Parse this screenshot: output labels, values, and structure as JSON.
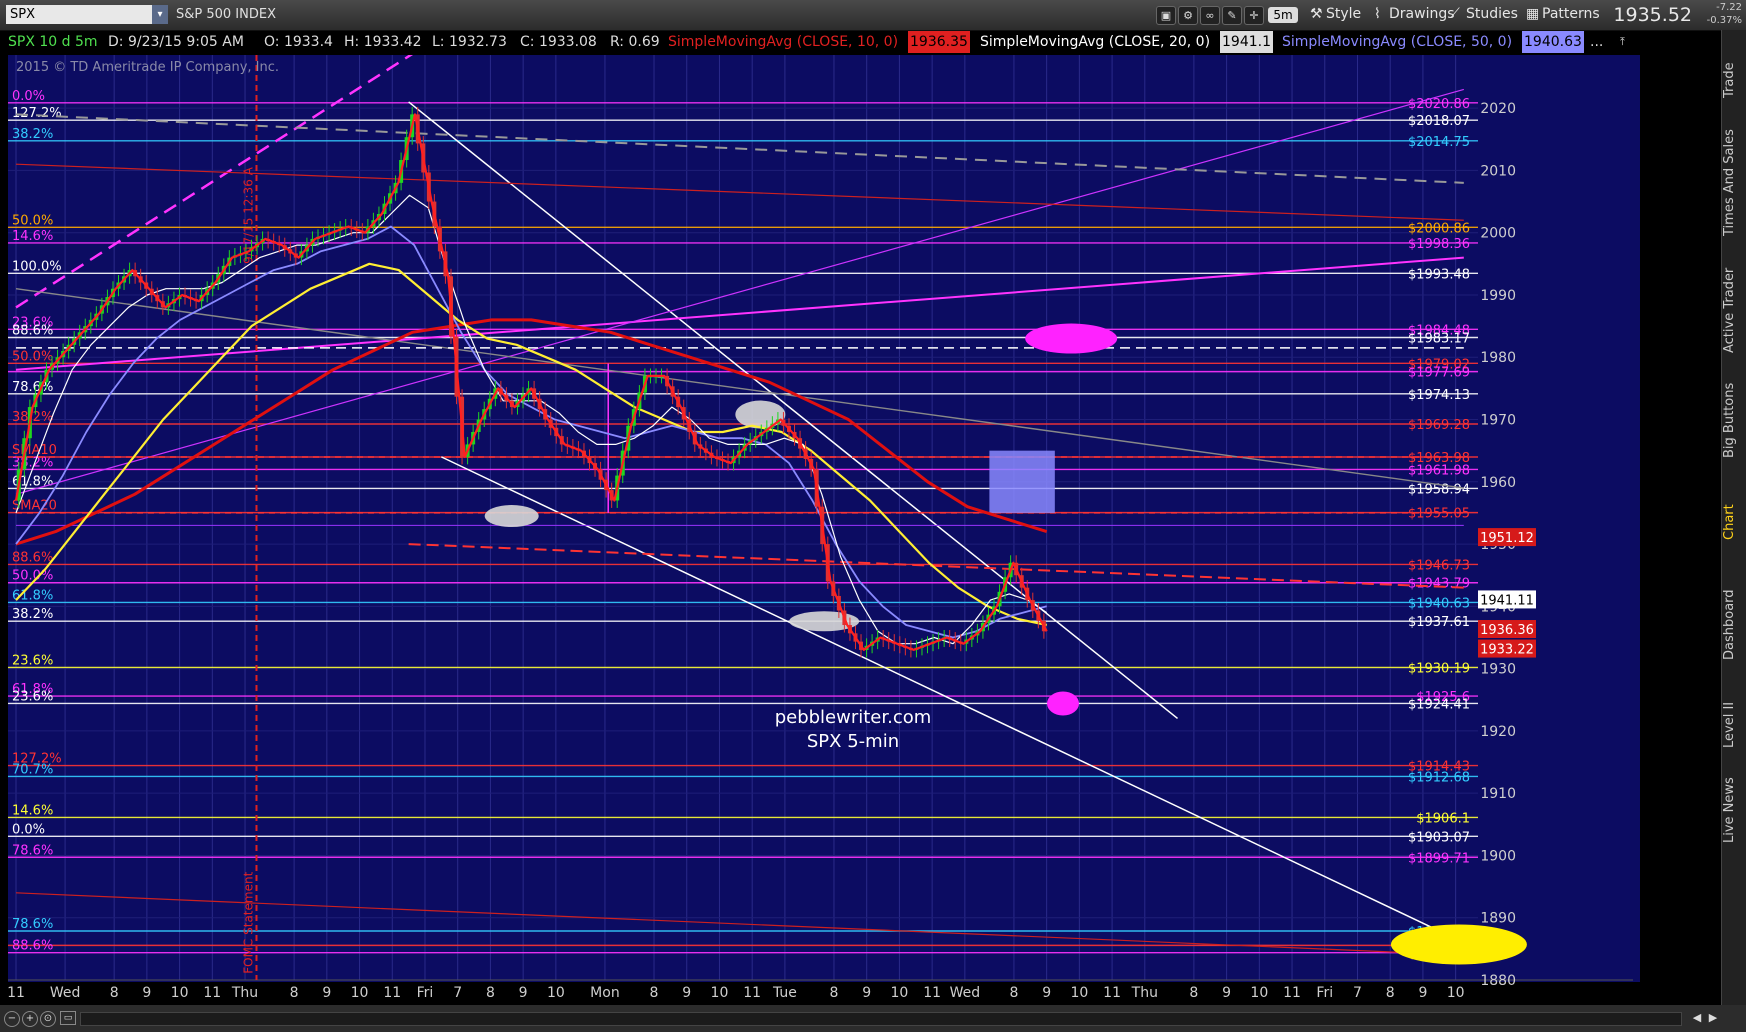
{
  "toolbar": {
    "symbol": "SPX",
    "symbol_name": "S&P 500 INDEX",
    "interval": "5m",
    "style_label": "Style",
    "drawings_label": "Drawings",
    "studies_label": "Studies",
    "patterns_label": "Patterns",
    "last_price": "1935.52",
    "change": "-7.22",
    "change_pct": "-0.37%"
  },
  "infobar": {
    "title": "SPX 10 d 5m",
    "date": "D: 9/23/15 9:05 AM",
    "open": "O: 1933.4",
    "high": "H: 1933.42",
    "low": "L: 1932.73",
    "close": "C: 1933.08",
    "range": "R: 0.69",
    "sma10_label": "SimpleMovingAvg (CLOSE, 10, 0)",
    "sma10_value": "1936.35",
    "sma20_label": "SimpleMovingAvg (CLOSE, 20, 0)",
    "sma20_value": "1941.1",
    "sma50_label": "SimpleMovingAvg (CLOSE, 50, 0)",
    "sma50_value": "1940.63",
    "more": "..."
  },
  "right_tabs": [
    "Trade",
    "Times And Sales",
    "Active Trader",
    "Big Buttons",
    "Chart",
    "Dashboard",
    "Level II",
    "Live News"
  ],
  "colors": {
    "background": "#0c0c62",
    "candle_up": "#1fd61f",
    "candle_down": "#e03030",
    "sma10": "#ffffff",
    "sma20": "#8a8aff",
    "sma50": "#ffee33",
    "sma200": "#e01010",
    "magenta": "#ff22ff",
    "trendline": "#ffffff"
  },
  "chart_data": {
    "type": "candlestick",
    "title": "SPX 5-min",
    "watermark": "pebblewriter.com",
    "copyright": "2015 © TD Ameritrade IP Company, Inc.",
    "ylim": [
      1880,
      2025
    ],
    "y_ticks": [
      2020,
      2010,
      2000,
      1990,
      1980,
      1970,
      1960,
      1950,
      1940,
      1930,
      1920,
      1910,
      1900,
      1890,
      1880
    ],
    "x_tick_labels": [
      {
        "x": 0,
        "label": "11"
      },
      {
        "x": 3,
        "label": "Wed"
      },
      {
        "x": 6,
        "label": "8"
      },
      {
        "x": 8,
        "label": "9"
      },
      {
        "x": 10,
        "label": "10"
      },
      {
        "x": 12,
        "label": "11"
      },
      {
        "x": 14,
        "label": "Thu"
      },
      {
        "x": 17,
        "label": "8"
      },
      {
        "x": 19,
        "label": "9"
      },
      {
        "x": 21,
        "label": "10"
      },
      {
        "x": 23,
        "label": "11"
      },
      {
        "x": 25,
        "label": "Fri"
      },
      {
        "x": 27,
        "label": "7"
      },
      {
        "x": 29,
        "label": "8"
      },
      {
        "x": 31,
        "label": "9"
      },
      {
        "x": 33,
        "label": "10"
      },
      {
        "x": 36,
        "label": "Mon"
      },
      {
        "x": 39,
        "label": "8"
      },
      {
        "x": 41,
        "label": "9"
      },
      {
        "x": 43,
        "label": "10"
      },
      {
        "x": 45,
        "label": "11"
      },
      {
        "x": 47,
        "label": "Tue"
      },
      {
        "x": 50,
        "label": "8"
      },
      {
        "x": 52,
        "label": "9"
      },
      {
        "x": 54,
        "label": "10"
      },
      {
        "x": 56,
        "label": "11"
      },
      {
        "x": 58,
        "label": "Wed"
      },
      {
        "x": 61,
        "label": "8"
      },
      {
        "x": 63,
        "label": "9"
      },
      {
        "x": 65,
        "label": "10"
      },
      {
        "x": 67,
        "label": "11"
      },
      {
        "x": 69,
        "label": "Thu"
      },
      {
        "x": 72,
        "label": "8"
      },
      {
        "x": 74,
        "label": "9"
      },
      {
        "x": 76,
        "label": "10"
      },
      {
        "x": 78,
        "label": "11"
      },
      {
        "x": 80,
        "label": "Fri"
      },
      {
        "x": 82,
        "label": "7"
      },
      {
        "x": 84,
        "label": "8"
      },
      {
        "x": 86,
        "label": "9"
      },
      {
        "x": 88,
        "label": "10"
      }
    ],
    "x_max": 89,
    "fomc_x": 14.7,
    "fomc_label": "FOMC Statement",
    "fomc_time": "9/17/15 12:36 A",
    "close_series": [
      1957,
      1972,
      1978,
      1981,
      1984,
      1987,
      1991,
      1994,
      1991,
      1988,
      1990,
      1989,
      1992,
      1996,
      1997,
      1999,
      1998,
      1996,
      1999,
      2000,
      2001,
      2000,
      2003,
      2008,
      2019,
      2005,
      1993,
      1964,
      1970,
      1975,
      1972,
      1975,
      1970,
      1966,
      1965,
      1962,
      1957,
      1969,
      1977,
      1977,
      1972,
      1966,
      1964,
      1963,
      1966,
      1968,
      1970,
      1967,
      1962,
      1944,
      1937,
      1933,
      1935,
      1934,
      1933,
      1934,
      1935,
      1934,
      1936,
      1940,
      1947,
      1941,
      1936
    ],
    "sma10_series": [
      1955,
      1963,
      1971,
      1978,
      1982,
      1985,
      1988,
      1990,
      1991,
      1991,
      1991,
      1992,
      1994,
      1996,
      1997,
      1998,
      1998,
      1999,
      2000,
      2000,
      2003,
      2006,
      2004,
      1994,
      1985,
      1978,
      1973,
      1973,
      1973,
      1971,
      1968,
      1966,
      1966,
      1967,
      1969,
      1972,
      1970,
      1967,
      1966,
      1966,
      1966,
      1967,
      1966,
      1958,
      1948,
      1941,
      1936,
      1934,
      1934,
      1935,
      1934,
      1937,
      1941,
      1942,
      1941,
      1939
    ],
    "sma20_series": [
      1950,
      1955,
      1961,
      1968,
      1974,
      1979,
      1983,
      1986,
      1988,
      1990,
      1992,
      1994,
      1995,
      1997,
      1998,
      1999,
      2001,
      1998,
      1991,
      1984,
      1978,
      1974,
      1972,
      1970,
      1969,
      1968,
      1967,
      1968,
      1969,
      1968,
      1967,
      1967,
      1966,
      1963,
      1957,
      1950,
      1944,
      1940,
      1937,
      1936,
      1935,
      1936,
      1938,
      1939,
      1940
    ],
    "sma50_series": [
      1941,
      1946,
      1952,
      1958,
      1964,
      1970,
      1975,
      1980,
      1985,
      1988,
      1991,
      1993,
      1995,
      1994,
      1990,
      1986,
      1983,
      1982,
      1980,
      1978,
      1975,
      1972,
      1970,
      1968,
      1968,
      1969,
      1968,
      1965,
      1961,
      1957,
      1952,
      1947,
      1943,
      1940,
      1938,
      1937
    ],
    "sma200_series": [
      1950,
      1952,
      1955,
      1958,
      1962,
      1966,
      1970,
      1974,
      1978,
      1981,
      1984,
      1985,
      1986,
      1986,
      1985,
      1984,
      1982,
      1980,
      1978,
      1976,
      1973,
      1970,
      1965,
      1960,
      1956,
      1954,
      1952
    ],
    "levels": [
      {
        "price": 2020.86,
        "label": "$2020.86",
        "left_label": "0.0%",
        "color": "#ff33ff"
      },
      {
        "price": 2018.07,
        "label": "$2018.07",
        "left_label": "127.2%",
        "color": "#ffffff"
      },
      {
        "price": 2014.75,
        "label": "$2014.75",
        "left_label": "38.2%",
        "color": "#33ccff"
      },
      {
        "price": 2000.86,
        "label": "$2000.86",
        "left_label": "50.0%",
        "color": "#ffaa00"
      },
      {
        "price": 1998.36,
        "label": "$1998.36",
        "left_label": "14.6%",
        "color": "#ff33ff"
      },
      {
        "price": 1993.48,
        "label": "$1993.48",
        "left_label": "100.0%",
        "color": "#ffffff"
      },
      {
        "price": 1984.48,
        "label": "$1984.48",
        "left_label": "23.6%",
        "color": "#ff33ff"
      },
      {
        "price": 1983.17,
        "label": "$1983.17",
        "left_label": "88.6%",
        "color": "#ffffff"
      },
      {
        "price": 1979.02,
        "label": "$1979.02",
        "left_label": "50.0%",
        "color": "#ff3333"
      },
      {
        "price": 1977.69,
        "label": "$1977.69",
        "left_label": "",
        "color": "#ff33ff"
      },
      {
        "price": 1974.13,
        "label": "$1974.13",
        "left_label": "78.6%",
        "color": "#ffffff"
      },
      {
        "price": 1969.28,
        "label": "$1969.28",
        "left_label": "38.2%",
        "color": "#ff3333"
      },
      {
        "price": 1963.98,
        "label": "$1963.98",
        "left_label": "SMA10",
        "color": "#ff3333"
      },
      {
        "price": 1961.98,
        "label": "$1961.98",
        "left_label": "38.2%",
        "color": "#ff33ff"
      },
      {
        "price": 1958.94,
        "label": "$1958.94",
        "left_label": "61.8%",
        "color": "#ffffff"
      },
      {
        "price": 1955.05,
        "label": "$1955.05",
        "left_label": "SMA20",
        "color": "#ff3333"
      },
      {
        "price": 1946.73,
        "label": "$1946.73",
        "left_label": "88.6%",
        "color": "#ff3333"
      },
      {
        "price": 1943.79,
        "label": "$1943.79",
        "left_label": "50.0%",
        "color": "#ff33ff"
      },
      {
        "price": 1940.63,
        "label": "$1940.63",
        "left_label": "61.8%",
        "color": "#33ccff"
      },
      {
        "price": 1937.61,
        "label": "$1937.61",
        "left_label": "38.2%",
        "color": "#ffffff"
      },
      {
        "price": 1930.19,
        "label": "$1930.19",
        "left_label": "23.6%",
        "color": "#ffff33"
      },
      {
        "price": 1925.6,
        "label": "$1925.6",
        "left_label": "61.8%",
        "color": "#ff33ff"
      },
      {
        "price": 1924.41,
        "label": "$1924.41",
        "left_label": "23.6%",
        "color": "#ffffff"
      },
      {
        "price": 1914.43,
        "label": "$1914.43",
        "left_label": "127.2%",
        "color": "#ff3333"
      },
      {
        "price": 1912.68,
        "label": "$1912.68",
        "left_label": "70.7%",
        "color": "#33ccff"
      },
      {
        "price": 1906.1,
        "label": "$1906.1",
        "left_label": "14.6%",
        "color": "#ffff33"
      },
      {
        "price": 1903.07,
        "label": "$1903.07",
        "left_label": "0.0%",
        "color": "#ffffff"
      },
      {
        "price": 1899.71,
        "label": "$1899.71",
        "left_label": "78.6%",
        "color": "#ff33ff"
      },
      {
        "price": 1887.87,
        "label": "$1887.87",
        "left_label": "78.6%",
        "color": "#33ccff"
      },
      {
        "price": 1885.56,
        "label": "$1885.56",
        "left_label": "",
        "color": "#ff3333"
      },
      {
        "price": 1884.38,
        "label": "$1884.38",
        "left_label": "88.6%",
        "color": "#ff33ff"
      }
    ],
    "price_tags": [
      {
        "price": 1951.12,
        "label": "1951.12",
        "bg": "#d61a1a",
        "fg": "#ffffff"
      },
      {
        "price": 1941.11,
        "label": "1941.11",
        "bg": "#ffffff",
        "fg": "#000000"
      },
      {
        "price": 1936.36,
        "label": "1936.36",
        "bg": "#d61a1a",
        "fg": "#ffffff"
      },
      {
        "price": 1933.22,
        "label": "1933.22",
        "bg": "#d61a1a",
        "fg": "#ffffff"
      }
    ]
  }
}
